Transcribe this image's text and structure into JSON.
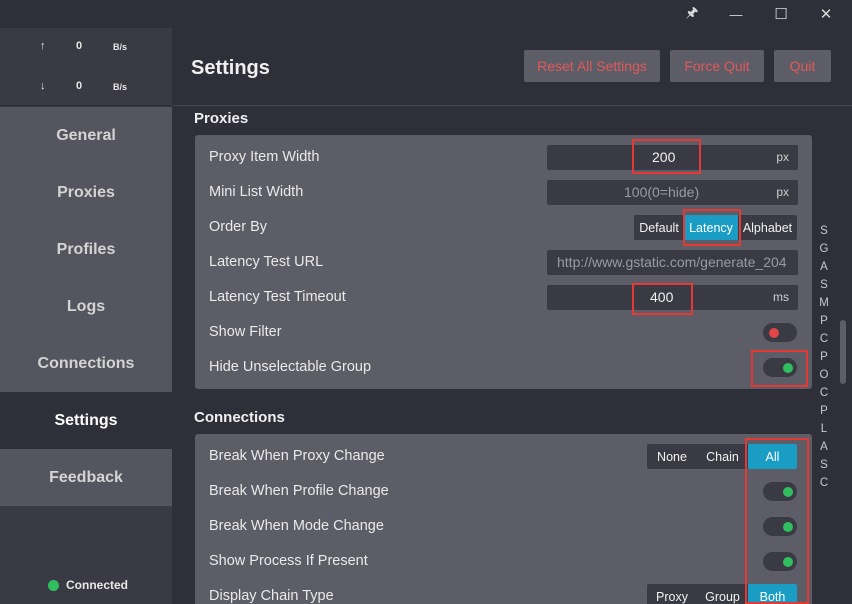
{
  "window": {
    "controls": {
      "pin": "🖈",
      "minimize": "—",
      "maximize": "☐",
      "close": "✕"
    }
  },
  "traffic": {
    "up_arrow": "↑",
    "up_value": "0",
    "up_unit": "B/s",
    "down_arrow": "↓",
    "down_value": "0",
    "down_unit": "B/s"
  },
  "sidebar": {
    "items": [
      {
        "label": "General"
      },
      {
        "label": "Proxies"
      },
      {
        "label": "Profiles"
      },
      {
        "label": "Logs"
      },
      {
        "label": "Connections"
      },
      {
        "label": "Settings"
      },
      {
        "label": "Feedback"
      }
    ],
    "status": "Connected"
  },
  "header": {
    "title": "Settings",
    "reset_label": "Reset All Settings",
    "force_quit_label": "Force Quit",
    "quit_label": "Quit"
  },
  "proxies": {
    "title": "Proxies",
    "item_width_label": "Proxy Item Width",
    "item_width_value": "200",
    "item_width_unit": "px",
    "mini_list_label": "Mini List Width",
    "mini_list_value": "100(0=hide)",
    "mini_list_unit": "px",
    "order_by_label": "Order By",
    "order_by_options": [
      "Default",
      "Latency",
      "Alphabet"
    ],
    "order_by_selected": "Latency",
    "latency_url_label": "Latency Test URL",
    "latency_url_value": "http://www.gstatic.com/generate_204",
    "latency_timeout_label": "Latency Test Timeout",
    "latency_timeout_value": "400",
    "latency_timeout_unit": "ms",
    "show_filter_label": "Show Filter",
    "show_filter_on": false,
    "hide_unselectable_label": "Hide Unselectable Group",
    "hide_unselectable_on": true
  },
  "connections": {
    "title": "Connections",
    "break_proxy_label": "Break When Proxy Change",
    "break_proxy_options": [
      "None",
      "Chain",
      "All"
    ],
    "break_proxy_selected": "All",
    "break_profile_label": "Break When Profile Change",
    "break_profile_on": true,
    "break_mode_label": "Break When Mode Change",
    "break_mode_on": true,
    "show_process_label": "Show Process If Present",
    "show_process_on": true,
    "display_chain_label": "Display Chain Type",
    "display_chain_options": [
      "Proxy",
      "Group",
      "Both"
    ],
    "display_chain_selected": "Both"
  },
  "alphabet_index": [
    "S",
    "G",
    "A",
    "S",
    "M",
    "P",
    "C",
    "P",
    "O",
    "C",
    "P",
    "L",
    "A",
    "S",
    "C"
  ],
  "colors": {
    "accent": "#1a9dc4",
    "danger_text": "#e05a5a",
    "toggle_on": "#2fbf5e",
    "toggle_off": "#e24646",
    "highlight": "#e53935"
  }
}
